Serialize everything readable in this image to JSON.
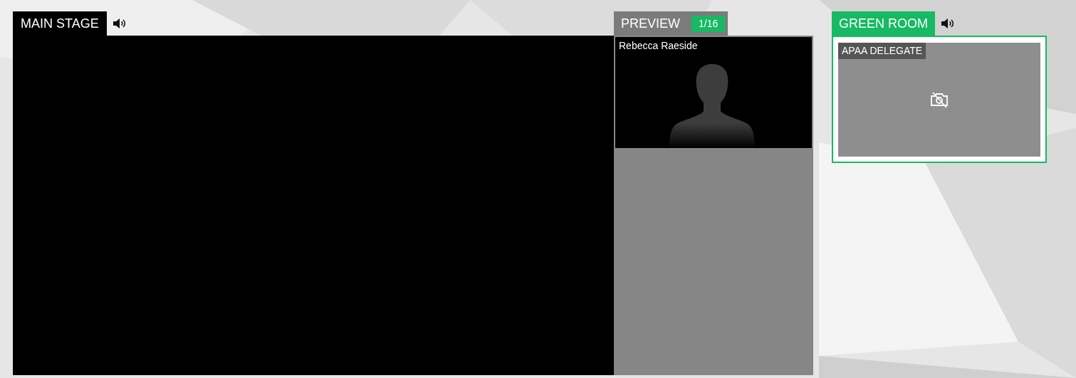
{
  "main_stage": {
    "title": "MAIN STAGE"
  },
  "preview": {
    "title": "PREVIEW",
    "count": "1/16",
    "tiles": [
      {
        "name": "Rebecca Raeside"
      }
    ]
  },
  "green_room": {
    "title": "GREEN ROOM",
    "tiles": [
      {
        "name": "APAA DELEGATE",
        "camera_off": true
      }
    ]
  }
}
